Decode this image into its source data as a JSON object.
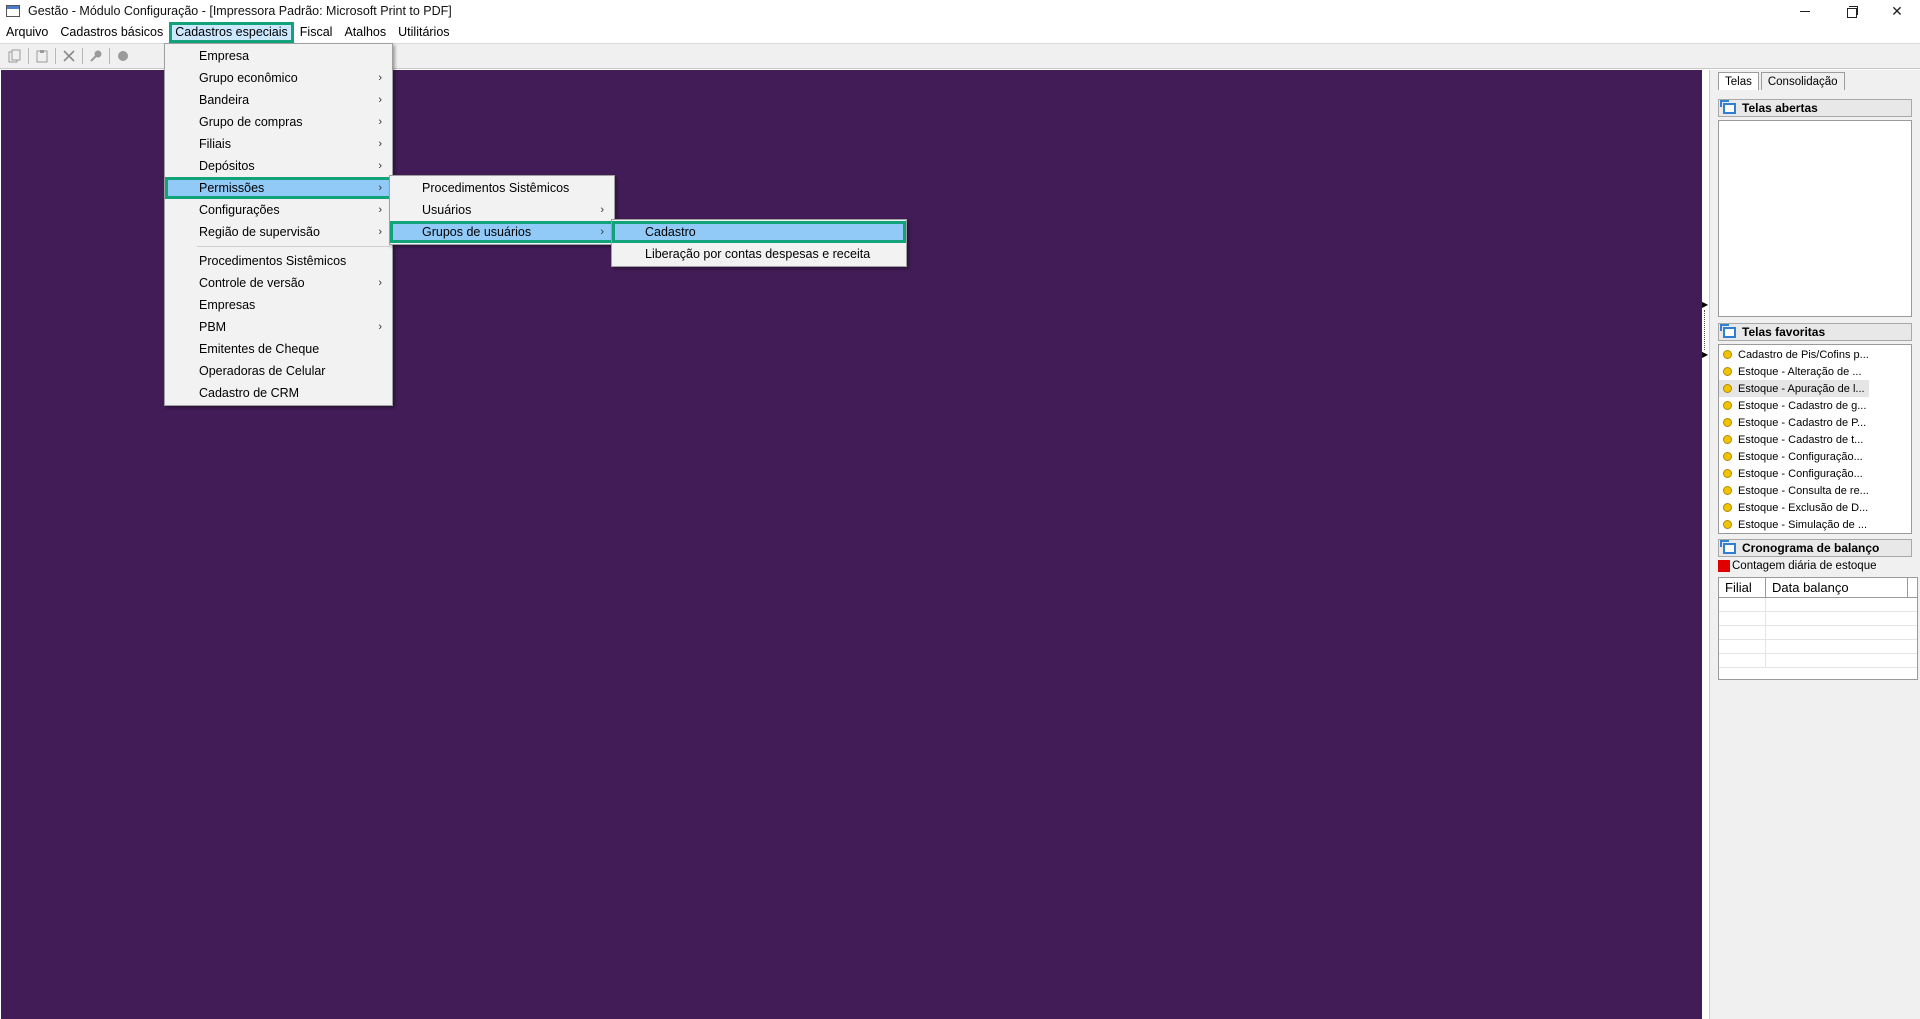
{
  "window": {
    "title": "Gestão  - Módulo Configuração - [Impressora Padrão: Microsoft Print to PDF]",
    "controls": {
      "close": "✕"
    }
  },
  "menubar": {
    "items": [
      "Arquivo",
      "Cadastros básicos",
      "Cadastros especiais",
      "Fiscal",
      "Atalhos",
      "Utilitários"
    ],
    "active": "Cadastros especiais"
  },
  "menu_level1": {
    "items": [
      {
        "label": "Empresa",
        "submenu": false
      },
      {
        "label": "Grupo econômico",
        "submenu": true
      },
      {
        "label": "Bandeira",
        "submenu": true
      },
      {
        "label": "Grupo de compras",
        "submenu": true
      },
      {
        "label": "Filiais",
        "submenu": true
      },
      {
        "label": "Depósitos",
        "submenu": true
      },
      {
        "label": "Permissões",
        "submenu": true
      },
      {
        "label": "Configurações",
        "submenu": true
      },
      {
        "label": "Região de supervisão",
        "submenu": true
      },
      {
        "label": "Procedimentos Sistêmicos",
        "submenu": false
      },
      {
        "label": "Controle de versão",
        "submenu": true
      },
      {
        "label": "Empresas",
        "submenu": false
      },
      {
        "label": "PBM",
        "submenu": true
      },
      {
        "label": "Emitentes de Cheque",
        "submenu": false
      },
      {
        "label": "Operadoras de Celular",
        "submenu": false
      },
      {
        "label": "Cadastro de CRM",
        "submenu": false
      }
    ],
    "highlighted": "Permissões",
    "arrow_glyph": "›"
  },
  "menu_level2": {
    "items": [
      {
        "label": "Procedimentos Sistêmicos"
      },
      {
        "label": "Usuários"
      },
      {
        "label": "Grupos de usuários"
      }
    ],
    "highlighted": "Grupos de usuários"
  },
  "menu_level3": {
    "items": [
      {
        "label": "Cadastro"
      },
      {
        "label": "Liberação por contas despesas e receita"
      }
    ],
    "highlighted": "Cadastro"
  },
  "right_panel": {
    "tabs": [
      "Telas",
      "Consolidação"
    ],
    "selected_tab": "Telas",
    "open_screens": {
      "title": "Telas abertas",
      "items": []
    },
    "favorites": {
      "title": "Telas favoritas",
      "items": [
        "Cadastro de Pis/Cofins p...",
        "Estoque - Alteração de ...",
        "Estoque - Apuração de l...",
        "Estoque - Cadastro de g...",
        "Estoque - Cadastro de P...",
        "Estoque - Cadastro de t...",
        "Estoque - Configuração...",
        "Estoque - Configuração...",
        "Estoque - Consulta de re...",
        "Estoque - Exclusão de D...",
        "Estoque - Simulação de ..."
      ],
      "highlighted_index": 2
    },
    "balance_schedule": {
      "title": "Cronograma de balanço",
      "legend": "Contagem diária de estoque",
      "legend_color": "#e00000",
      "columns": [
        "Filial",
        "Data balanço"
      ]
    }
  },
  "colors": {
    "workspace": "#421c57",
    "menu_highlight": "#91c9f7",
    "focus_outline": "#12a37a"
  }
}
